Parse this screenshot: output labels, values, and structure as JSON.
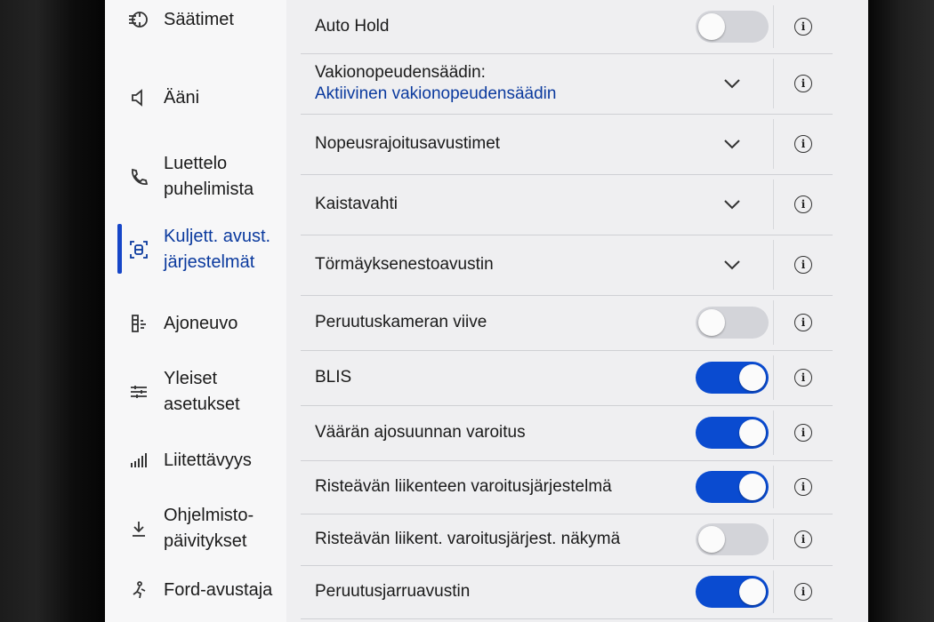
{
  "sidebar": {
    "items": [
      {
        "label": "Säätimet",
        "icon": "controls-icon"
      },
      {
        "label": "Ääni",
        "icon": "speaker-icon"
      },
      {
        "label": "Luettelo\npuhelimista",
        "icon": "phone-icon"
      },
      {
        "label": "Kuljett. avust.\njärjestelmät",
        "icon": "driver-assist-icon",
        "active": true
      },
      {
        "label": "Ajoneuvo",
        "icon": "vehicle-icon"
      },
      {
        "label": "Yleiset\nasetukset",
        "icon": "sliders-icon"
      },
      {
        "label": "Liitettävyys",
        "icon": "signal-bars-icon"
      },
      {
        "label": "Ohjelmisto-\npäivitykset",
        "icon": "download-icon"
      },
      {
        "label": "Ford-avustaja",
        "icon": "assistant-icon"
      }
    ]
  },
  "settings": [
    {
      "label": "Auto Hold",
      "control": "toggle",
      "state": "off"
    },
    {
      "label": "Vakionopeudensäädin:",
      "sublabel": "Aktiivinen vakionopeudensäädin",
      "control": "dropdown"
    },
    {
      "label": "Nopeusrajoitusavustimet",
      "control": "dropdown"
    },
    {
      "label": "Kaistavahti",
      "control": "dropdown"
    },
    {
      "label": "Törmäyksenestoavustin",
      "control": "dropdown"
    },
    {
      "label": "Peruutuskameran viive",
      "control": "toggle",
      "state": "off"
    },
    {
      "label": "BLIS",
      "control": "toggle",
      "state": "on"
    },
    {
      "label": "Väärän ajosuunnan varoitus",
      "control": "toggle",
      "state": "on"
    },
    {
      "label": "Risteävän liikenteen varoitusjärjestelmä",
      "control": "toggle",
      "state": "on"
    },
    {
      "label": "Risteävän liikent. varoitusjärjest. näkymä",
      "control": "toggle",
      "state": "off"
    },
    {
      "label": "Peruutusjarruavustin",
      "control": "toggle",
      "state": "on"
    }
  ],
  "colors": {
    "accent": "#0a4bd0",
    "active_text": "#0b3a9e",
    "toggle_off": "#d3d4d9"
  }
}
